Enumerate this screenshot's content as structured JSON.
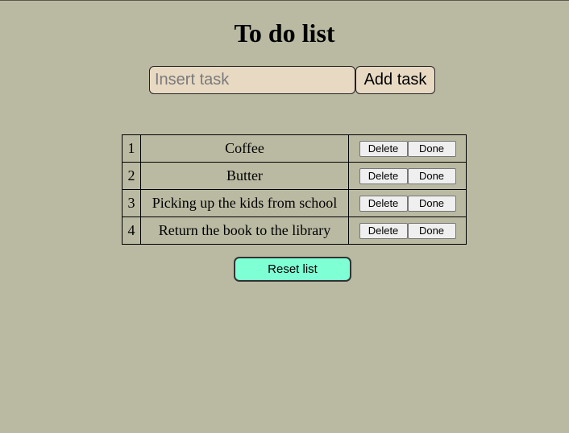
{
  "header": {
    "title": "To do list"
  },
  "add_form": {
    "input_value": "",
    "input_placeholder": "Insert task",
    "add_label": "Add task"
  },
  "tasks": [
    {
      "num": "1",
      "text": "Coffee",
      "delete_label": "Delete",
      "done_label": "Done"
    },
    {
      "num": "2",
      "text": "Butter",
      "delete_label": "Delete",
      "done_label": "Done"
    },
    {
      "num": "3",
      "text": "Picking up the kids from school",
      "delete_label": "Delete",
      "done_label": "Done"
    },
    {
      "num": "4",
      "text": "Return the book to the library",
      "delete_label": "Delete",
      "done_label": "Done"
    }
  ],
  "footer": {
    "reset_label": "Reset list"
  },
  "colors": {
    "background": "#babaa3",
    "input_background": "#e8d9c3",
    "reset_background": "#7fffd4"
  }
}
